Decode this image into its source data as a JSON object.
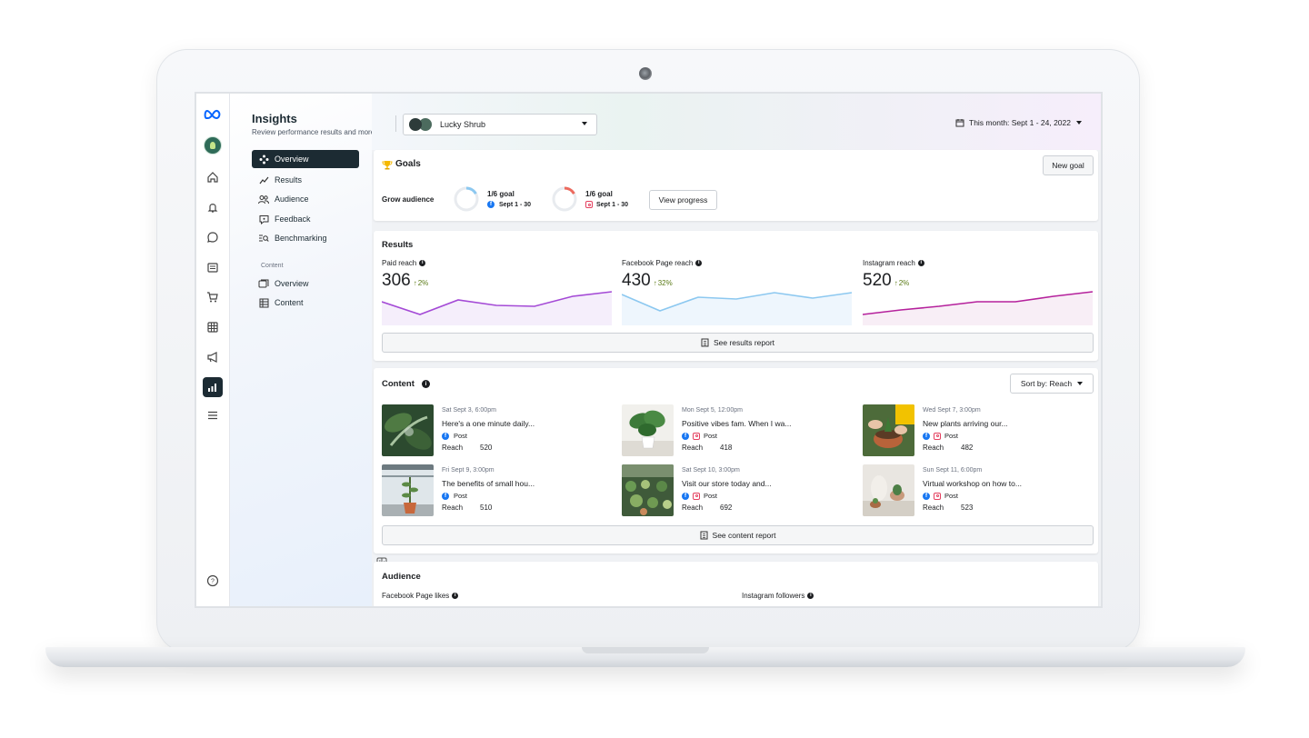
{
  "app": {
    "title": "Insights",
    "subtitle": "Review performance results and more."
  },
  "account": {
    "name": "Lucky Shrub"
  },
  "date_range": "This month: Sept 1 - 24, 2022",
  "nav": {
    "items": [
      {
        "label": "Overview",
        "icon": "overview-icon",
        "active": true
      },
      {
        "label": "Results",
        "icon": "results-icon"
      },
      {
        "label": "Audience",
        "icon": "audience-icon"
      },
      {
        "label": "Feedback",
        "icon": "feedback-icon"
      },
      {
        "label": "Benchmarking",
        "icon": "benchmarking-icon"
      }
    ],
    "section_label": "Content",
    "content_items": [
      {
        "label": "Overview",
        "icon": "content-overview-icon"
      },
      {
        "label": "Content",
        "icon": "content-table-icon"
      }
    ]
  },
  "rail": {
    "icons": [
      "meta-logo",
      "profile-avatar",
      "home-icon",
      "bell-icon",
      "chat-icon",
      "pages-icon",
      "cart-icon",
      "table-icon",
      "megaphone-icon",
      "insights-icon",
      "menu-icon",
      "help-icon"
    ]
  },
  "goals": {
    "heading": "Goals",
    "new_goal": "New goal",
    "row_label": "Grow audience",
    "items": [
      {
        "progress_text": "1/6 goal",
        "dates": "Sept 1 - 30",
        "platform": "facebook",
        "fraction": 0.1667,
        "color": "#8cc8f0"
      },
      {
        "progress_text": "1/6 goal",
        "dates": "Sept 1 - 30",
        "platform": "instagram",
        "fraction": 0.1667,
        "color": "#ec6a5e"
      }
    ],
    "view_progress": "View progress"
  },
  "results": {
    "heading": "Results",
    "stats": [
      {
        "label": "Paid reach",
        "value": "306",
        "change": "2%",
        "color": "#a44ad6"
      },
      {
        "label": "Facebook Page reach",
        "value": "430",
        "change": "32%",
        "color": "#8cc8f0"
      },
      {
        "label": "Instagram reach",
        "value": "520",
        "change": "2%",
        "color": "#b5219c"
      }
    ],
    "report_button": "See results report"
  },
  "content": {
    "heading": "Content",
    "sort": "Sort by: Reach",
    "reach_label": "Reach",
    "posts": [
      {
        "date": "Sat Sept 3, 6:00pm",
        "title": "Here's a one minute daily...",
        "type": "Post",
        "reach": "520",
        "instagram": false
      },
      {
        "date": "Mon Sept 5, 12:00pm",
        "title": "Positive vibes fam. When I wa...",
        "type": "Post",
        "reach": "418",
        "instagram": true
      },
      {
        "date": "Wed Sept 7, 3:00pm",
        "title": "New plants arriving our...",
        "type": "Post",
        "reach": "482",
        "instagram": true
      },
      {
        "date": "Fri Sept 9, 3:00pm",
        "title": "The benefits of small hou...",
        "type": "Post",
        "reach": "510",
        "instagram": false
      },
      {
        "date": "Sat Sept 10, 3:00pm",
        "title": "Visit our store today and...",
        "type": "Post",
        "reach": "692",
        "instagram": true
      },
      {
        "date": "Sun Sept 11, 6:00pm",
        "title": "Virtual workshop on how to...",
        "type": "Post",
        "reach": "523",
        "instagram": true
      }
    ],
    "report_button": "See content report"
  },
  "audience": {
    "heading": "Audience",
    "facebook_label": "Facebook Page likes",
    "instagram_label": "Instagram followers"
  }
}
